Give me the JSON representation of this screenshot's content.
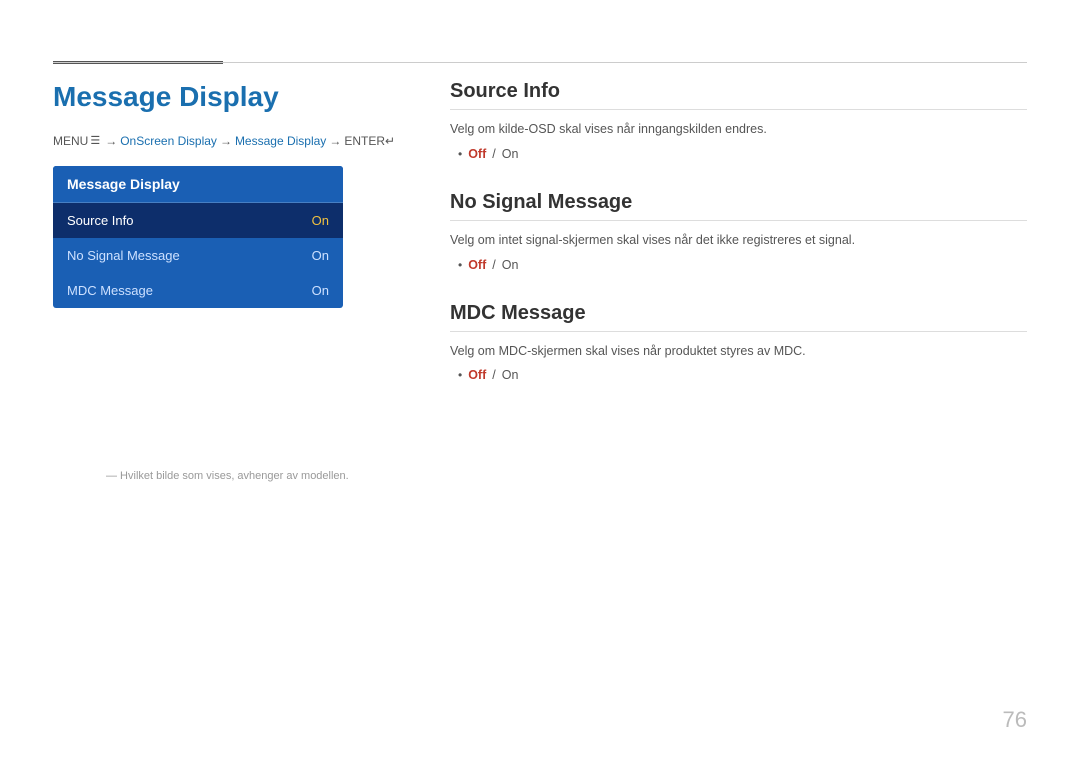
{
  "page": {
    "title": "Message Display",
    "page_number": "76"
  },
  "breadcrumb": {
    "menu_label": "MENU",
    "menu_icon": "☰",
    "arrow": "→",
    "step1": "OnScreen Display",
    "step2": "Message Display",
    "enter_label": "ENTER",
    "enter_icon": "↵"
  },
  "menu_panel": {
    "header": "Message Display",
    "items": [
      {
        "label": "Source Info",
        "value": "On",
        "active": true
      },
      {
        "label": "No Signal Message",
        "value": "On",
        "active": false
      },
      {
        "label": "MDC Message",
        "value": "On",
        "active": false
      }
    ]
  },
  "footnote": "― Hvilket bilde som vises, avhenger av modellen.",
  "sections": [
    {
      "id": "source-info",
      "title": "Source Info",
      "description": "Velg om kilde-OSD skal vises når inngangskilden endres.",
      "option_off": "Off",
      "option_sep": " / ",
      "option_on": "On"
    },
    {
      "id": "no-signal-message",
      "title": "No Signal Message",
      "description": "Velg om intet signal-skjermen skal vises når det ikke registreres et signal.",
      "option_off": "Off",
      "option_sep": " / ",
      "option_on": "On"
    },
    {
      "id": "mdc-message",
      "title": "MDC Message",
      "description": "Velg om MDC-skjermen skal vises når produktet styres av MDC.",
      "option_off": "Off",
      "option_sep": " / ",
      "option_on": "On"
    }
  ]
}
